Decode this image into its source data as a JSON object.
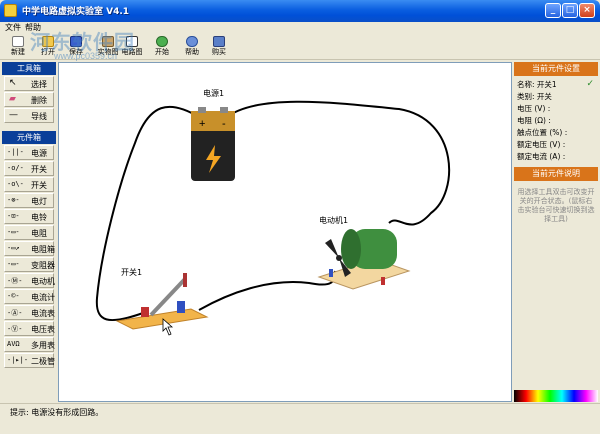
{
  "window": {
    "title": "中学电路虚拟实验室 V4.1"
  },
  "menu": {
    "items": [
      "文件",
      "帮助"
    ]
  },
  "toolbar": {
    "buttons": [
      {
        "label": "新建",
        "icon": "new-doc-icon"
      },
      {
        "label": "打开",
        "icon": "open-folder-icon"
      },
      {
        "label": "保存",
        "icon": "save-icon"
      },
      {
        "label": "实物图",
        "icon": "physical-view-icon"
      },
      {
        "label": "电路图",
        "icon": "schematic-icon"
      },
      {
        "label": "开始",
        "icon": "start-icon"
      },
      {
        "label": "帮助",
        "icon": "help-icon"
      },
      {
        "label": "购买",
        "icon": "buy-icon"
      }
    ]
  },
  "watermark": {
    "main": "河东软件园",
    "sub": "www.pc0359.cn"
  },
  "toolbox": {
    "title": "工具箱",
    "tools": [
      {
        "label": "选择",
        "icon": "arrow-cursor-icon"
      },
      {
        "label": "删除",
        "icon": "eraser-icon"
      },
      {
        "label": "导线",
        "icon": "wire-icon"
      }
    ]
  },
  "components": {
    "title": "元件箱",
    "items": [
      {
        "symbol": "-||-",
        "label": "电源"
      },
      {
        "symbol": "-o/-",
        "label": "开关"
      },
      {
        "symbol": "-o\\-",
        "label": "开关"
      },
      {
        "symbol": "-⊗-",
        "label": "电灯"
      },
      {
        "symbol": "-⊡-",
        "label": "电铃"
      },
      {
        "symbol": "-▭-",
        "label": "电阻"
      },
      {
        "symbol": "-▭↗",
        "label": "电阻箱"
      },
      {
        "symbol": "-▭-",
        "label": "变阻器"
      },
      {
        "symbol": "-Ⓜ-",
        "label": "电动机"
      },
      {
        "symbol": "-©-",
        "label": "电流计"
      },
      {
        "symbol": "-Ⓐ-",
        "label": "电流表"
      },
      {
        "symbol": "-Ⓥ-",
        "label": "电压表"
      },
      {
        "symbol": "AVΩ",
        "label": "多用表"
      },
      {
        "symbol": "-|▸|-",
        "label": "二极管"
      }
    ]
  },
  "canvas": {
    "battery_label": "电源1",
    "motor_label": "电动机1",
    "switch_label": "开关1",
    "battery_plus": "+",
    "battery_minus": "-"
  },
  "properties": {
    "title": "当前元件设置",
    "rows": [
      {
        "label": "名称: 开关1",
        "checked": true
      },
      {
        "label": "类别: 开关"
      },
      {
        "label": "电压 (V) :"
      },
      {
        "label": "电阻 (Ω) :"
      },
      {
        "label": "触点位置 (%) :"
      },
      {
        "label": "额定电压 (V) :"
      },
      {
        "label": "额定电流 (A) :"
      }
    ]
  },
  "description": {
    "title": "当前元件说明",
    "text": "用选择工具双击可改变开关的开合状态。(鼠标右击实验台可快速切换到选择工具)"
  },
  "status": {
    "text": "提示: 电源没有形成回路。"
  },
  "colors": {
    "panel_head": "#0a3f99",
    "orange_head": "#d9741a",
    "title_bar": "#0050d8"
  }
}
